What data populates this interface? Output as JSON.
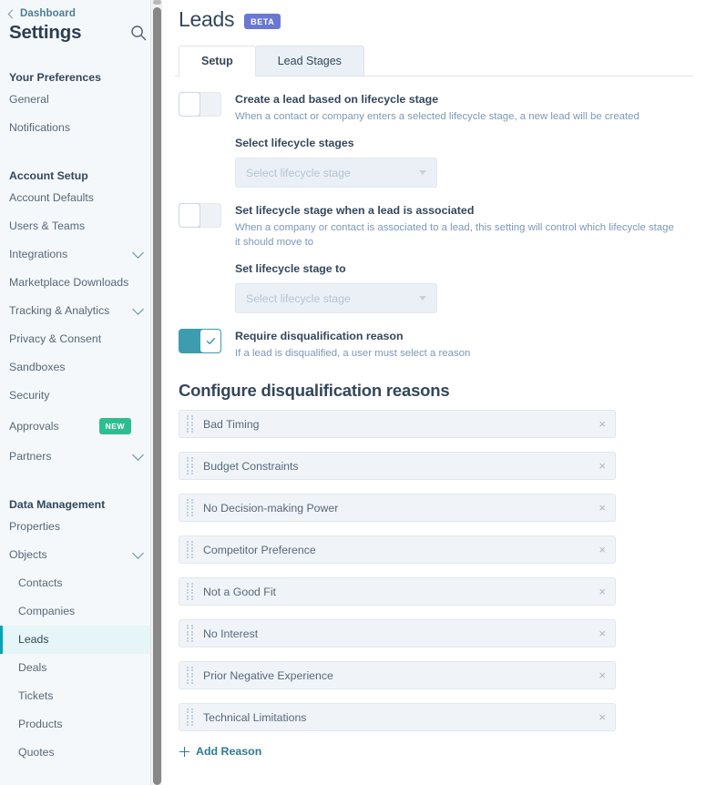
{
  "sidebar": {
    "back_label": "Dashboard",
    "title": "Settings",
    "search_icon": "search-icon",
    "groups": [
      {
        "title": "Your Preferences",
        "items": [
          {
            "label": "General",
            "chevron": false,
            "badge": null,
            "active": false,
            "sub": false
          },
          {
            "label": "Notifications",
            "chevron": false,
            "badge": null,
            "active": false,
            "sub": false
          }
        ]
      },
      {
        "title": "Account Setup",
        "items": [
          {
            "label": "Account Defaults",
            "chevron": false,
            "badge": null,
            "active": false,
            "sub": false
          },
          {
            "label": "Users & Teams",
            "chevron": false,
            "badge": null,
            "active": false,
            "sub": false
          },
          {
            "label": "Integrations",
            "chevron": true,
            "badge": null,
            "active": false,
            "sub": false
          },
          {
            "label": "Marketplace Downloads",
            "chevron": false,
            "badge": null,
            "active": false,
            "sub": false
          },
          {
            "label": "Tracking & Analytics",
            "chevron": true,
            "badge": null,
            "active": false,
            "sub": false
          },
          {
            "label": "Privacy & Consent",
            "chevron": false,
            "badge": null,
            "active": false,
            "sub": false
          },
          {
            "label": "Sandboxes",
            "chevron": false,
            "badge": null,
            "active": false,
            "sub": false
          },
          {
            "label": "Security",
            "chevron": false,
            "badge": null,
            "active": false,
            "sub": false
          },
          {
            "label": "Approvals",
            "chevron": false,
            "badge": "NEW",
            "active": false,
            "sub": false
          },
          {
            "label": "Partners",
            "chevron": true,
            "badge": null,
            "active": false,
            "sub": false
          }
        ]
      },
      {
        "title": "Data Management",
        "items": [
          {
            "label": "Properties",
            "chevron": false,
            "badge": null,
            "active": false,
            "sub": false
          },
          {
            "label": "Objects",
            "chevron": true,
            "badge": null,
            "active": false,
            "sub": false
          },
          {
            "label": "Contacts",
            "chevron": false,
            "badge": null,
            "active": false,
            "sub": true
          },
          {
            "label": "Companies",
            "chevron": false,
            "badge": null,
            "active": false,
            "sub": true
          },
          {
            "label": "Leads",
            "chevron": false,
            "badge": null,
            "active": true,
            "sub": true
          },
          {
            "label": "Deals",
            "chevron": false,
            "badge": null,
            "active": false,
            "sub": true
          },
          {
            "label": "Tickets",
            "chevron": false,
            "badge": null,
            "active": false,
            "sub": true
          },
          {
            "label": "Products",
            "chevron": false,
            "badge": null,
            "active": false,
            "sub": true
          },
          {
            "label": "Quotes",
            "chevron": false,
            "badge": null,
            "active": false,
            "sub": true
          }
        ]
      }
    ]
  },
  "header": {
    "title": "Leads",
    "badge": "BETA"
  },
  "tabs": [
    {
      "label": "Setup",
      "active": true
    },
    {
      "label": "Lead Stages",
      "active": false
    }
  ],
  "settings": [
    {
      "toggle_state": "off",
      "title": "Create a lead based on lifecycle stage",
      "description": "When a contact or company enters a selected lifecycle stage, a new lead will be created",
      "field_label": "Select lifecycle stages",
      "select_value": "Select lifecycle stage"
    },
    {
      "toggle_state": "off",
      "title": "Set lifecycle stage when a lead is associated",
      "description": "When a company or contact is associated to a lead, this setting will control which lifecycle stage it should move to",
      "field_label": "Set lifecycle stage to",
      "select_value": "Select lifecycle stage"
    },
    {
      "toggle_state": "on",
      "title": "Require disqualification reason",
      "description": "If a lead is disqualified, a user must select a reason",
      "field_label": null,
      "select_value": null
    }
  ],
  "disqualification": {
    "section_title": "Configure disqualification reasons",
    "reasons": [
      "Bad Timing",
      "Budget Constraints",
      "No Decision-making Power",
      "Competitor Preference",
      "Not a Good Fit",
      "No Interest",
      "Prior Negative Experience",
      "Technical Limitations"
    ],
    "remove_glyph": "×",
    "add_label": "Add Reason"
  },
  "colors": {
    "accent_teal": "#00a4bd",
    "toggle_on": "#3d9cb0",
    "badge_new": "#2dbe8f",
    "badge_beta": "#6a78d1",
    "sidebar_bg": "#f5f8fa",
    "text_primary": "#33475b"
  }
}
